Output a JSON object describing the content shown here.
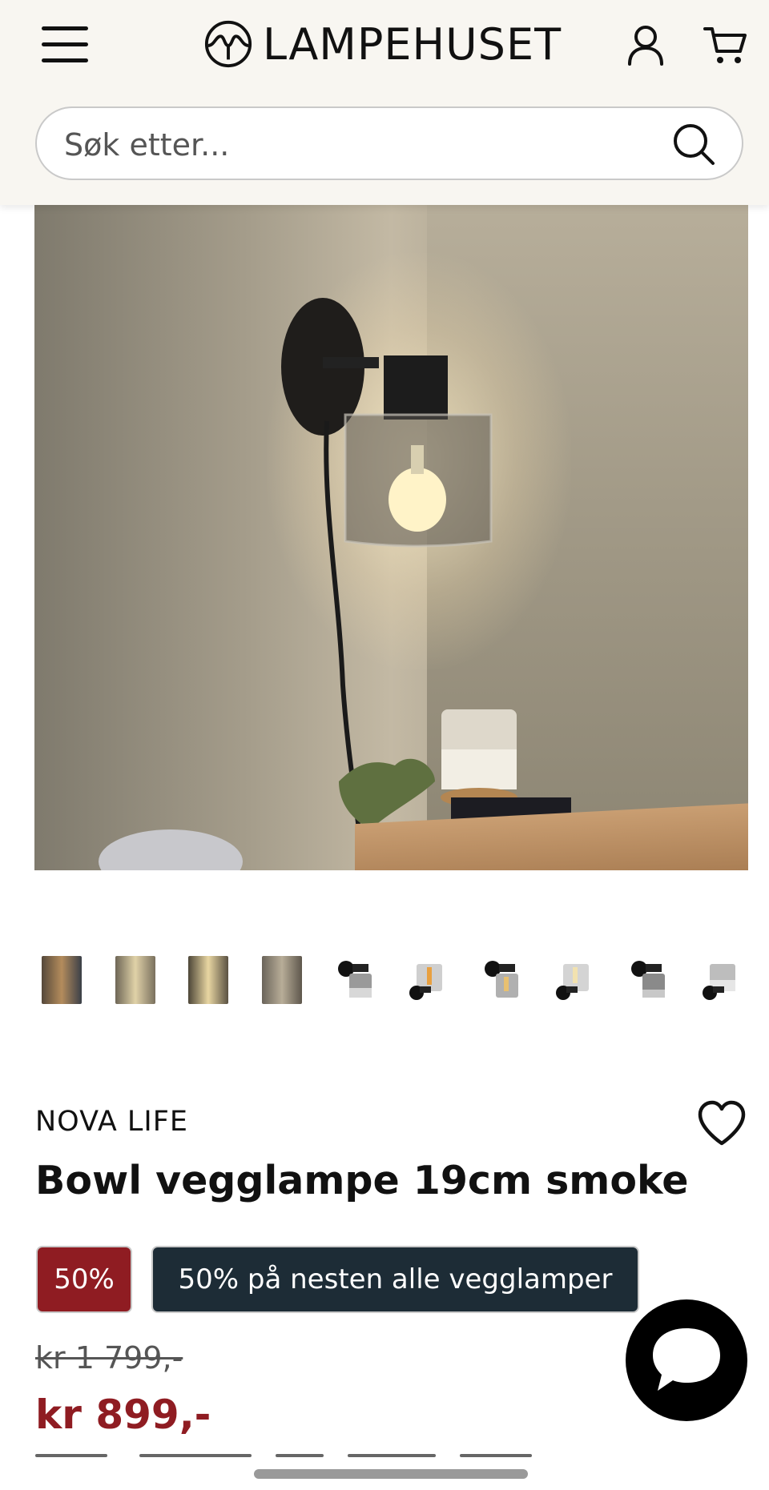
{
  "header": {
    "brand_name": "LAMPEHUSET",
    "menu_icon": "hamburger-menu-icon",
    "account_icon": "user-icon",
    "cart_icon": "shopping-cart-icon"
  },
  "search": {
    "placeholder": "Søk etter...",
    "icon": "search-icon"
  },
  "gallery": {
    "thumbnail_count": 10
  },
  "product": {
    "brand": "NOVA LIFE",
    "title": "Bowl vegglampe 19cm smoke",
    "discount_badge": "50%",
    "campaign_badge": "50% på nesten alle vegglamper",
    "old_price": "kr 1 799,-",
    "price": "kr 899,-",
    "wishlist_icon": "heart-icon"
  },
  "chat": {
    "icon": "chat-bubble-icon"
  },
  "colors": {
    "header_bg": "#f8f6f1",
    "sale_red": "#8f1c22",
    "campaign_dark": "#1d2c36"
  }
}
